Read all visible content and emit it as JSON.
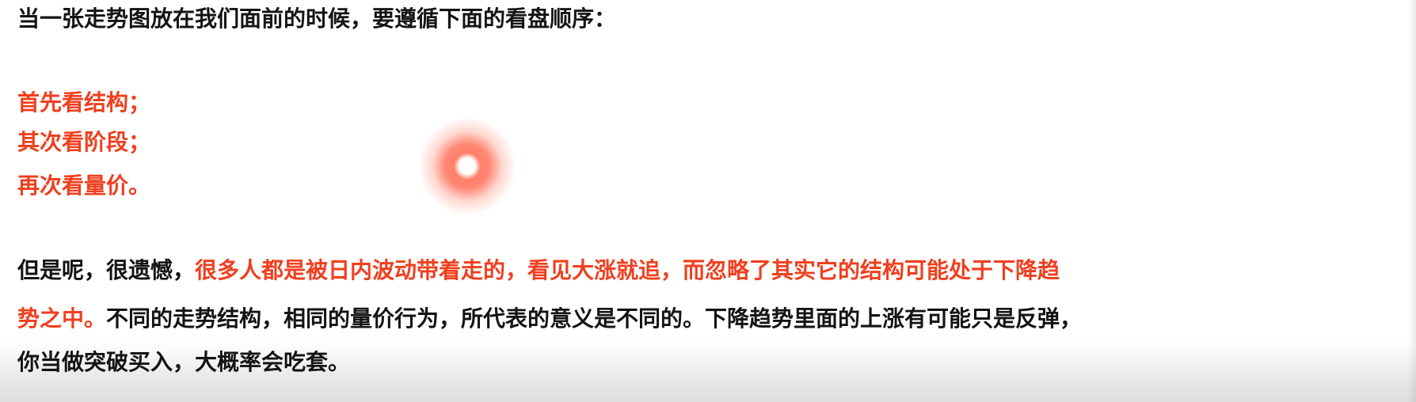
{
  "intro": "当一张走势图放在我们面前的时候，要遵循下面的看盘顺序：",
  "steps": [
    "首先看结构；",
    "其次看阶段；",
    "再次看量价。"
  ],
  "paragraph": {
    "p1_dark": "但是呢，很遗憾，",
    "p1_red": "很多人都是被日内波动带着走的，看见大涨就追，而忽略了其实它的结构可能处于下降趋",
    "p2_red": "势之中。",
    "p2_dark": "不同的走势结构，相同的量价行为，所代表的意义是不同的。下降趋势里面的上涨有可能只是反弹，",
    "p3_dark": "你当做突破买入，大概率会吃套。"
  },
  "colors": {
    "text": "#141414",
    "highlight": "#ef3f1f",
    "background": "#ffffff"
  }
}
